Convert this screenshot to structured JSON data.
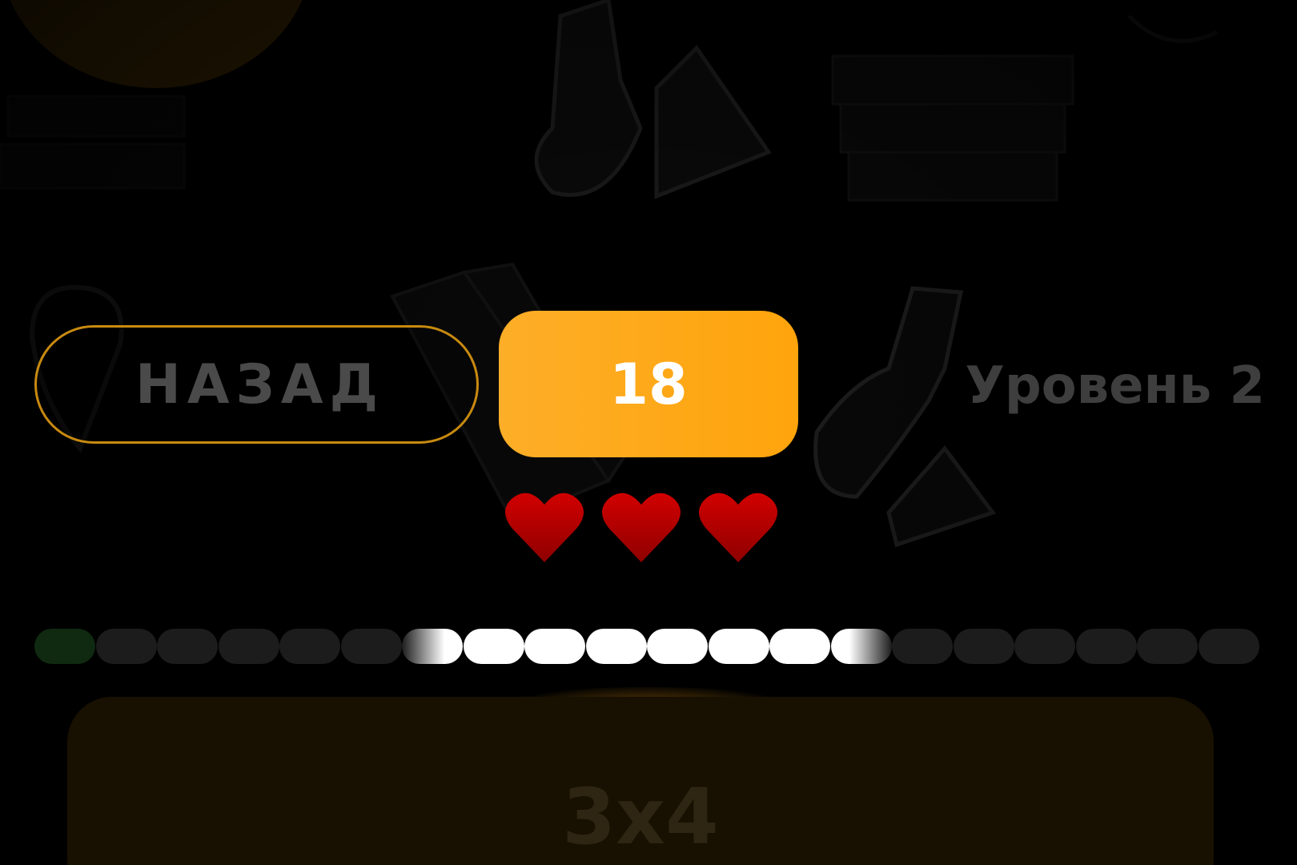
{
  "header": {
    "back_label": "НАЗАД",
    "timer_value": "18",
    "level_label": "Уровень 2"
  },
  "lives": {
    "count": 3,
    "max": 3,
    "color": "#d20000"
  },
  "progress": {
    "total_segments": 20,
    "states": [
      "correct",
      "pending",
      "pending",
      "pending",
      "pending",
      "pending",
      "active",
      "active",
      "active",
      "active",
      "active",
      "active",
      "active",
      "active",
      "pending",
      "pending",
      "pending",
      "pending",
      "pending",
      "pending"
    ],
    "colors": {
      "correct": "#0f2a10",
      "pending": "#1c1c1c",
      "active": "#ffffff"
    }
  },
  "question": {
    "text": "3x4"
  },
  "colors": {
    "accent": "#ffa40c",
    "background": "#000000"
  }
}
